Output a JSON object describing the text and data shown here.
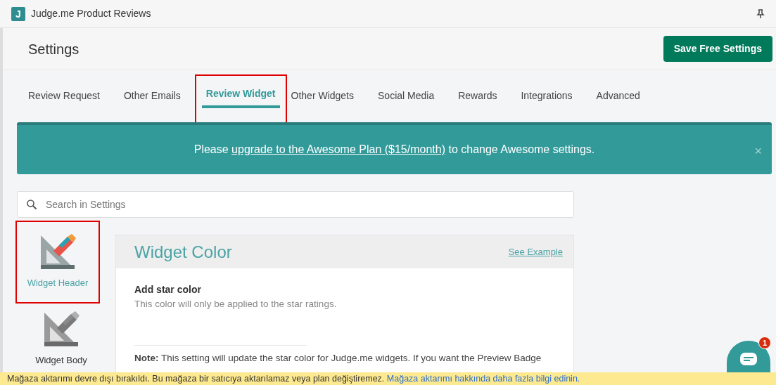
{
  "app": {
    "logo": "J",
    "title": "Judge.me Product Reviews"
  },
  "header": {
    "title": "Settings",
    "button": "Save Free Settings"
  },
  "tabs": [
    {
      "label": "Review Request",
      "selected": false
    },
    {
      "label": "Other Emails",
      "selected": false
    },
    {
      "label": "Review Widget",
      "selected": true,
      "highlighted": true
    },
    {
      "label": "Other Widgets",
      "selected": false
    },
    {
      "label": "Social Media",
      "selected": false
    },
    {
      "label": "Rewards",
      "selected": false
    },
    {
      "label": "Integrations",
      "selected": false
    },
    {
      "label": "Advanced",
      "selected": false
    }
  ],
  "banner": {
    "before": "Please ",
    "link": "upgrade to the Awesome Plan ($15/month)",
    "after": " to change Awesome settings.",
    "close": "×"
  },
  "search": {
    "placeholder": "Search in Settings"
  },
  "sidebar": {
    "items": [
      {
        "label": "Widget Header",
        "selected": true,
        "highlighted": true
      },
      {
        "label": "Widget Body",
        "selected": false
      }
    ]
  },
  "card": {
    "title": "Widget Color",
    "link": "See Example",
    "setting_label": "Add star color",
    "setting_help": "This color will only be applied to the star ratings.",
    "note": "**Note:** This setting will update the star color for Judge.me widgets. If you want the Preview Badge"
  },
  "chat": {
    "badge": "1"
  },
  "notice": {
    "text": "Mağaza aktarımı devre dışı bırakıldı. Bu mağaza bir satıcıya aktarılamaz veya plan değiştiremez.",
    "link": "Mağaza aktarımı hakkında daha fazla bilgi edinin."
  }
}
